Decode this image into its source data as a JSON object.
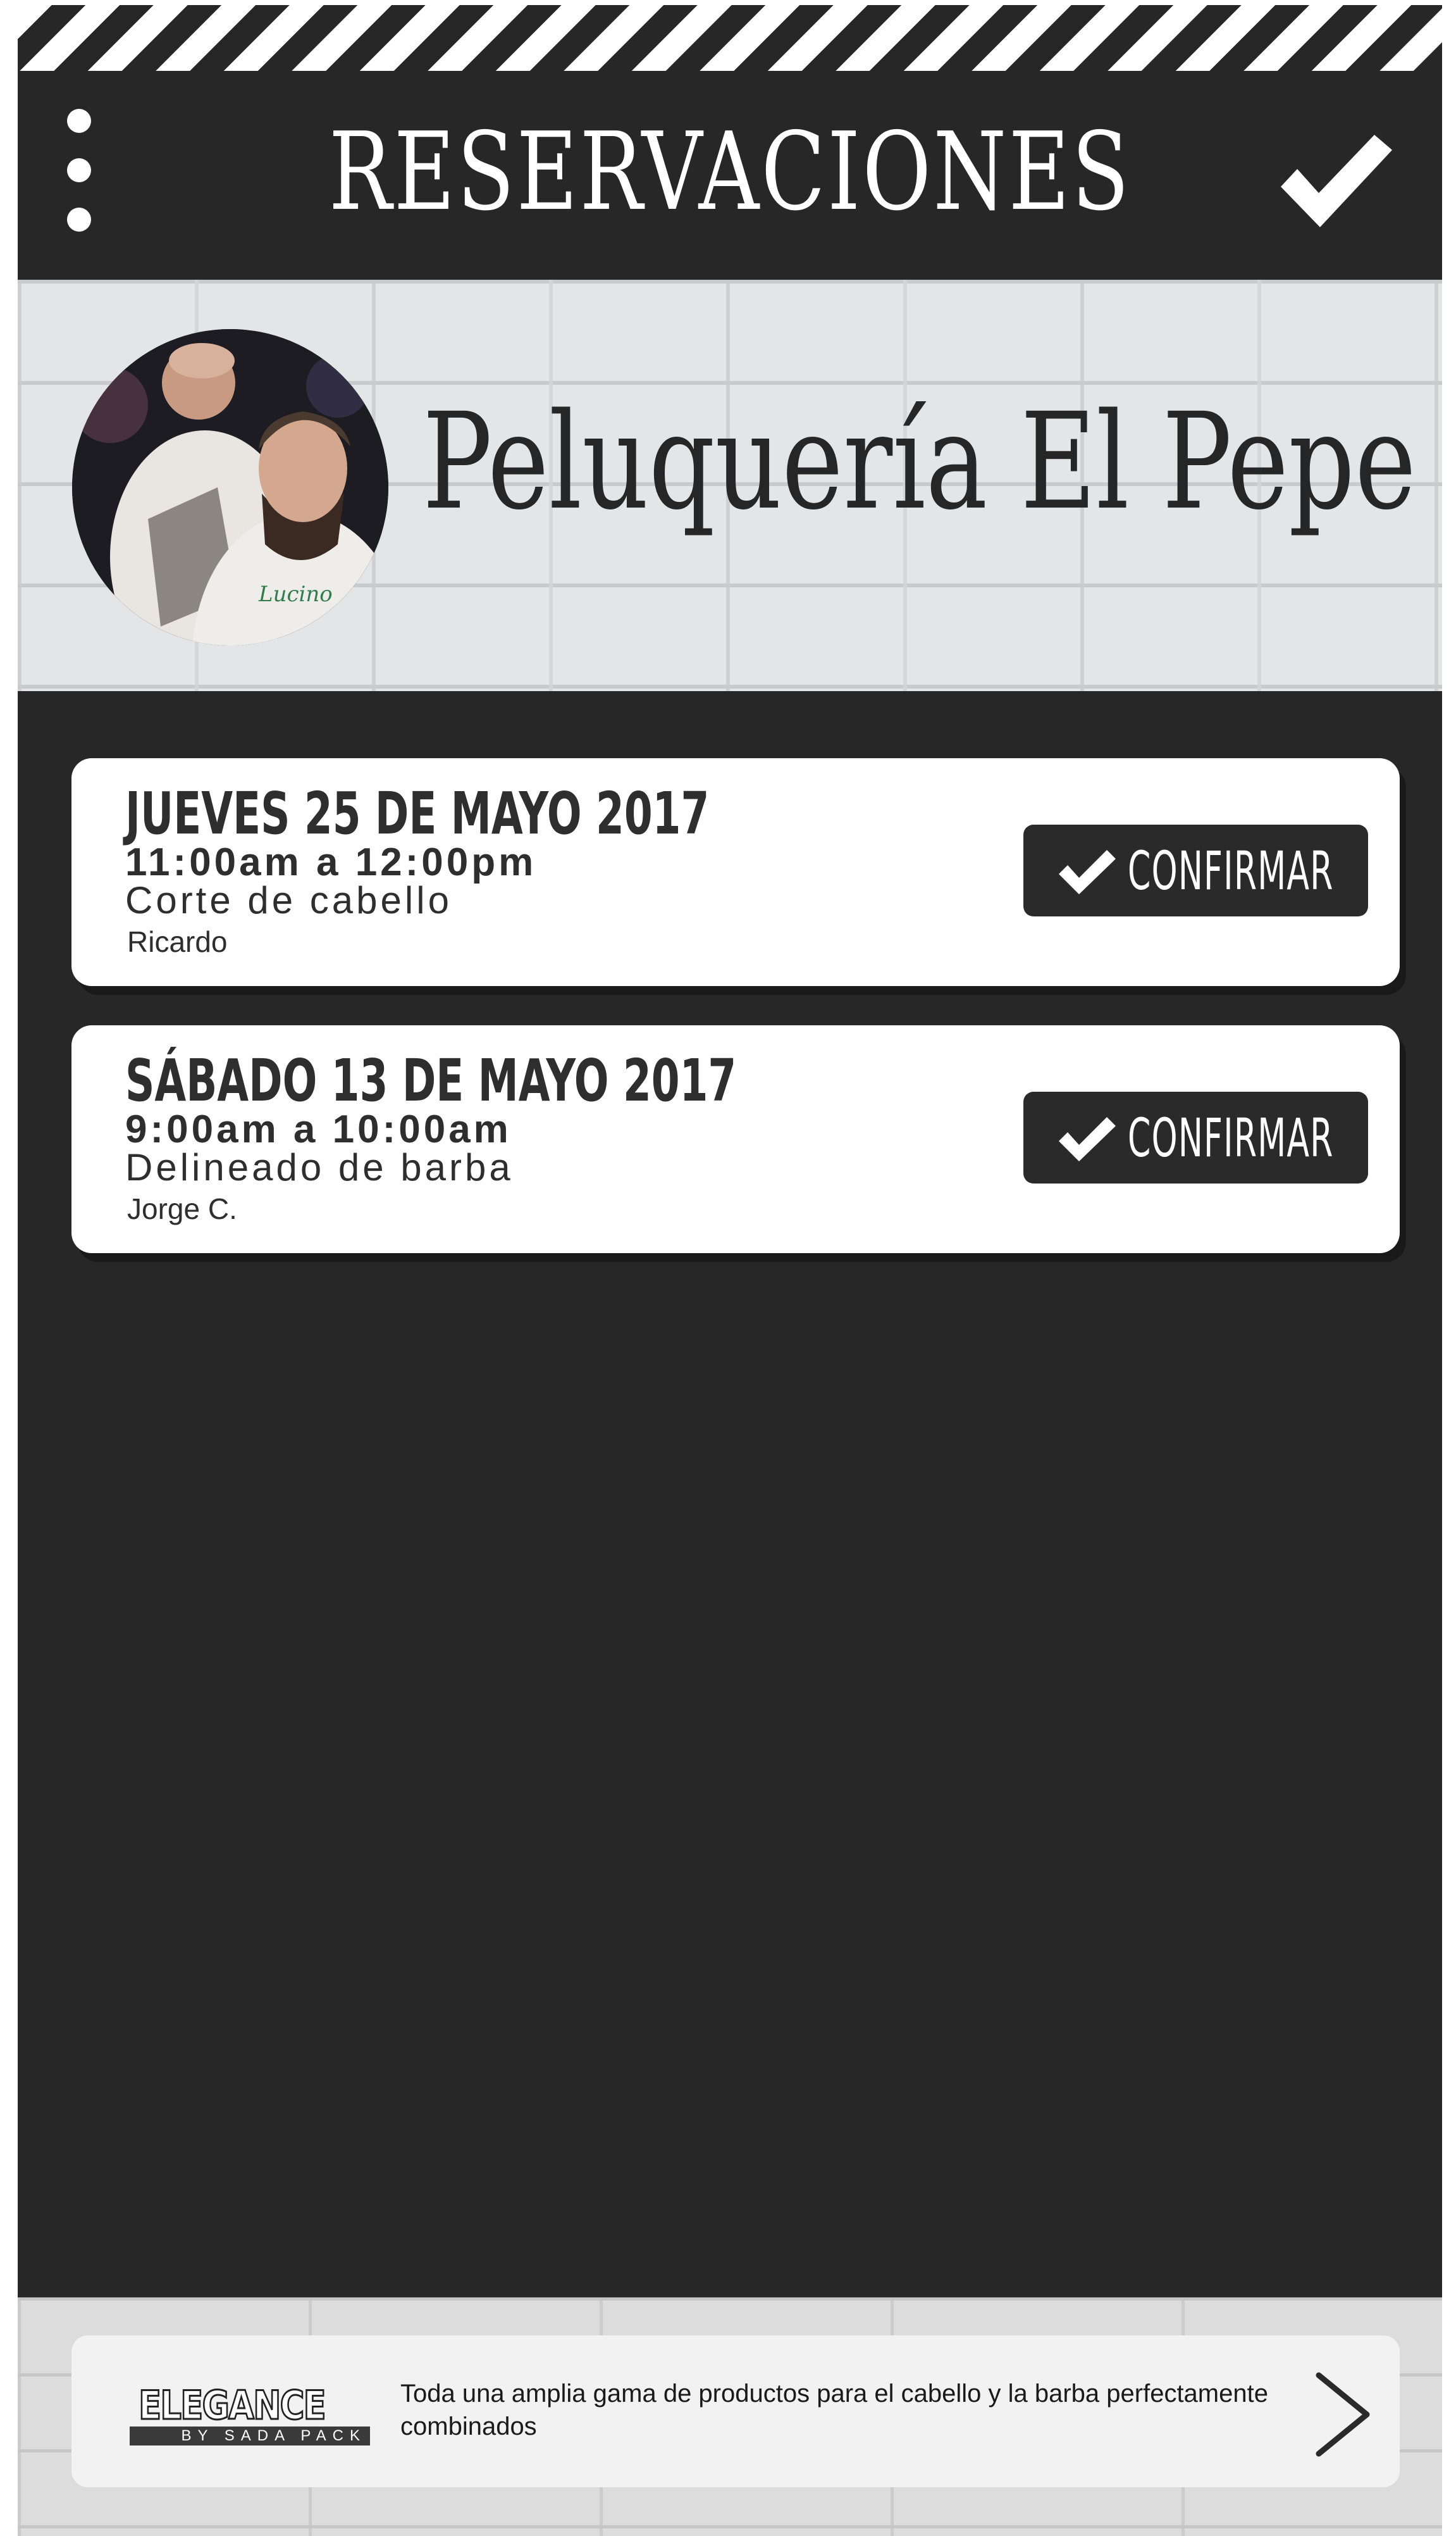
{
  "header": {
    "title": "RESERVACIONES"
  },
  "shop": {
    "name": "Peluquería El Pepe"
  },
  "reservations": [
    {
      "date": "JUEVES 25 DE MAYO 2017",
      "time": "11:00am a 12:00pm",
      "service": "Corte de cabello",
      "barber": "Ricardo",
      "confirm_label": "CONFIRMAR"
    },
    {
      "date": "SÁBADO 13 DE MAYO 2017",
      "time": "9:00am a 10:00am",
      "service": "Delineado de barba",
      "barber": "Jorge C.",
      "confirm_label": "CONFIRMAR"
    }
  ],
  "ad": {
    "brand": "ELEGANCE",
    "brand_sub": "BY SADA PACK",
    "text": "Toda una amplia gama de productos para el cabello y la barba perfectamente combinados"
  },
  "icons": {
    "menu": "vertical-dots-icon",
    "done": "checkmark-icon",
    "confirm": "checkmark-icon",
    "next": "chevron-right-icon"
  },
  "colors": {
    "background": "#282727",
    "card": "#ffffff",
    "accent": "#2a2a2a"
  }
}
